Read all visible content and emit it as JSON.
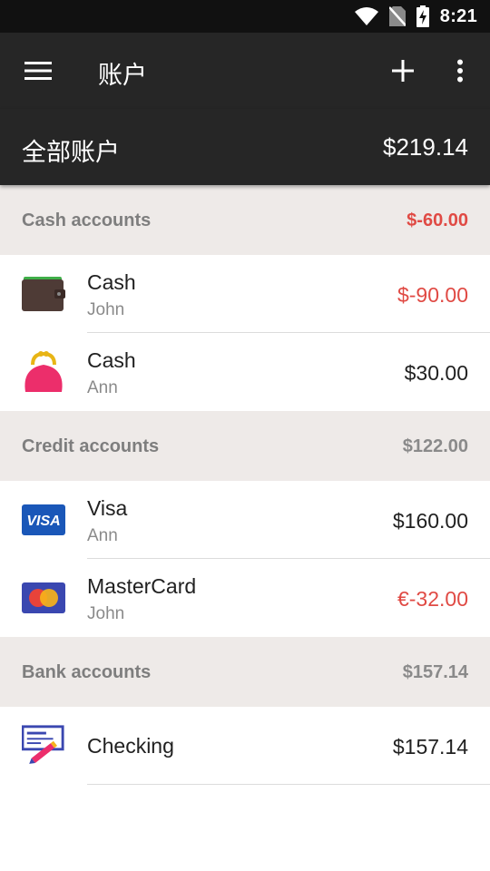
{
  "status": {
    "time": "8:21"
  },
  "app_bar": {
    "title": "账户"
  },
  "summary": {
    "label": "全部账户",
    "total": "$219.14"
  },
  "groups": [
    {
      "title": "Cash accounts",
      "total": "$-60.00",
      "accounts": [
        {
          "name": "Cash",
          "owner": "John",
          "amount": "$-90.00",
          "icon": "wallet-icon"
        },
        {
          "name": "Cash",
          "owner": "Ann",
          "amount": "$30.00",
          "icon": "coin-purse-icon"
        }
      ]
    },
    {
      "title": "Credit accounts",
      "total": "$122.00",
      "accounts": [
        {
          "name": "Visa",
          "owner": "Ann",
          "amount": "$160.00",
          "icon": "visa-card-icon",
          "card_label": "VISA"
        },
        {
          "name": "MasterCard",
          "owner": "John",
          "amount": "€-32.00",
          "icon": "mastercard-icon"
        }
      ]
    },
    {
      "title": "Bank accounts",
      "total": "$157.14",
      "accounts": [
        {
          "name": "Checking",
          "amount": "$157.14",
          "icon": "cheque-icon"
        }
      ]
    }
  ],
  "colors": {
    "negative": "#e04a44",
    "app_bar": "#262626",
    "header_bg": "#eeeae8"
  }
}
